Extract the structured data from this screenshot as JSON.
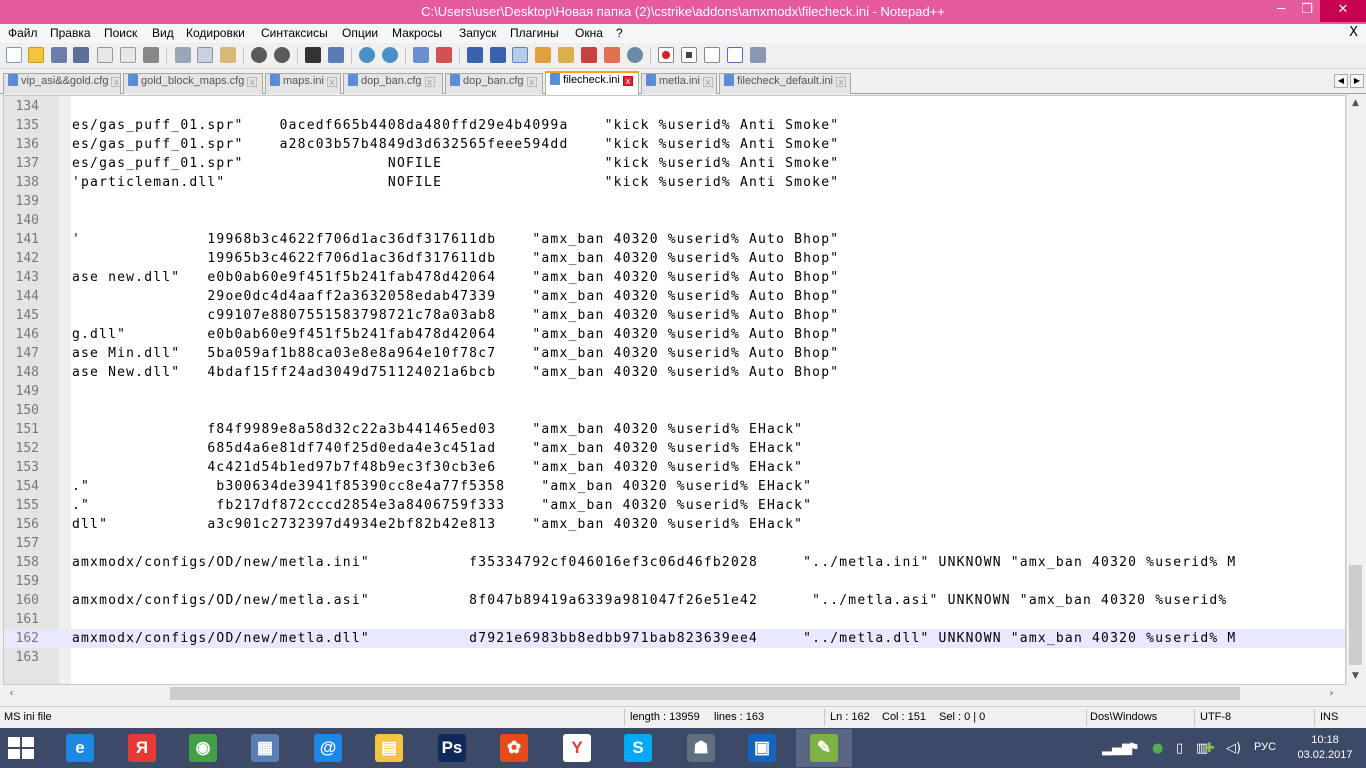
{
  "window": {
    "title": "C:\\Users\\user\\Desktop\\Новая папка (2)\\cstrike\\addons\\amxmodx\\filecheck.ini - Notepad++",
    "minimize": "─",
    "maximize": "❐",
    "close": "✕"
  },
  "menu": {
    "items": [
      "Файл",
      "Правка",
      "Поиск",
      "Вид",
      "Кодировки",
      "Синтаксисы",
      "Опции",
      "Макросы",
      "Запуск",
      "Плагины",
      "Окна",
      "?"
    ],
    "close_doc": "X"
  },
  "toolbar": {
    "icons": [
      "new-file-icon",
      "open-file-icon",
      "save-icon",
      "save-all-icon",
      "close-icon",
      "close-all-icon",
      "print-icon",
      "cut-icon",
      "copy-icon",
      "paste-icon",
      "undo-icon",
      "redo-icon",
      "find-icon",
      "replace-icon",
      "zoom-in-icon",
      "zoom-out-icon",
      "sync-v-icon",
      "sync-h-icon",
      "word-wrap-icon",
      "show-all-chars-icon",
      "indent-guide-icon",
      "udl-icon",
      "doc-map-icon",
      "function-list-icon",
      "folder-workspace-icon",
      "monitoring-icon",
      "record-macro-icon",
      "stop-macro-icon",
      "play-macro-icon",
      "play-multiple-icon",
      "save-macro-icon"
    ]
  },
  "tabs": [
    {
      "label": "vip_asi&&gold.cfg",
      "active": false
    },
    {
      "label": "gold_block_maps.cfg",
      "active": false
    },
    {
      "label": "maps.ini",
      "active": false
    },
    {
      "label": "dop_ban.cfg",
      "active": false
    },
    {
      "label": "dop_ban.cfg",
      "active": false
    },
    {
      "label": "filecheck.ini",
      "active": true
    },
    {
      "label": "metla.ini",
      "active": false
    },
    {
      "label": "filecheck_default.ini",
      "active": false
    }
  ],
  "editor": {
    "current_line": "162",
    "lines": [
      {
        "n": "134",
        "t": ""
      },
      {
        "n": "135",
        "t": "es/gas_puff_01.spr\"    0acedf665b4408da480ffd29e4b4099a    \"kick %userid% Anti Smoke\""
      },
      {
        "n": "136",
        "t": "es/gas_puff_01.spr\"    a28c03b57b4849d3d632565feee594dd    \"kick %userid% Anti Smoke\""
      },
      {
        "n": "137",
        "t": "es/gas_puff_01.spr\"                NOFILE                  \"kick %userid% Anti Smoke\""
      },
      {
        "n": "138",
        "t": "'particleman.dll\"                  NOFILE                  \"kick %userid% Anti Smoke\""
      },
      {
        "n": "139",
        "t": ""
      },
      {
        "n": "140",
        "t": ""
      },
      {
        "n": "141",
        "t": "'              19968b3c4622f706d1ac36df317611db    \"amx_ban 40320 %userid% Auto Bhop\""
      },
      {
        "n": "142",
        "t": "               19965b3c4622f706d1ac36df317611db    \"amx_ban 40320 %userid% Auto Bhop\""
      },
      {
        "n": "143",
        "t": "ase new.dll\"   e0b0ab60e9f451f5b241fab478d42064    \"amx_ban 40320 %userid% Auto Bhop\""
      },
      {
        "n": "144",
        "t": "               29oe0dc4d4aaff2a3632058edab47339    \"amx_ban 40320 %userid% Auto Bhop\""
      },
      {
        "n": "145",
        "t": "               c99107e8807551583798721c78a03ab8    \"amx_ban 40320 %userid% Auto Bhop\""
      },
      {
        "n": "146",
        "t": "g.dll\"         e0b0ab60e9f451f5b241fab478d42064    \"amx_ban 40320 %userid% Auto Bhop\""
      },
      {
        "n": "147",
        "t": "ase Min.dll\"   5ba059af1b88ca03e8e8a964e10f78c7    \"amx_ban 40320 %userid% Auto Bhop\""
      },
      {
        "n": "148",
        "t": "ase New.dll\"   4bdaf15ff24ad3049d751124021a6bcb    \"amx_ban 40320 %userid% Auto Bhop\""
      },
      {
        "n": "149",
        "t": ""
      },
      {
        "n": "150",
        "t": ""
      },
      {
        "n": "151",
        "t": "               f84f9989e8a58d32c22a3b441465ed03    \"amx_ban 40320 %userid% EHack\""
      },
      {
        "n": "152",
        "t": "               685d4a6e81df740f25d0eda4e3c451ad    \"amx_ban 40320 %userid% EHack\""
      },
      {
        "n": "153",
        "t": "               4c421d54b1ed97b7f48b9ec3f30cb3e6    \"amx_ban 40320 %userid% EHack\""
      },
      {
        "n": "154",
        "t": ".\"              b300634de3941f85390cc8e4a77f5358    \"amx_ban 40320 %userid% EHack\""
      },
      {
        "n": "155",
        "t": ".\"              fb217df872cccd2854e3a8406759f333    \"amx_ban 40320 %userid% EHack\""
      },
      {
        "n": "156",
        "t": "dll\"           a3c901c2732397d4934e2bf82b42e813    \"amx_ban 40320 %userid% EHack\""
      },
      {
        "n": "157",
        "t": ""
      },
      {
        "n": "158",
        "t": "amxmodx/configs/OD/new/metla.ini\"           f35334792cf046016ef3c06d46fb2028     \"../metla.ini\" UNKNOWN \"amx_ban 40320 %userid% M"
      },
      {
        "n": "159",
        "t": ""
      },
      {
        "n": "160",
        "t": "amxmodx/configs/OD/new/metla.asi\"           8f047b89419a6339a981047f26e51e42      \"../metla.asi\" UNKNOWN \"amx_ban 40320 %userid%"
      },
      {
        "n": "161",
        "t": ""
      },
      {
        "n": "162",
        "t": "amxmodx/configs/OD/new/metla.dll\"           d7921e6983bb8edbb971bab823639ee4     \"../metla.dll\" UNKNOWN \"amx_ban 40320 %userid% M"
      },
      {
        "n": "163",
        "t": ""
      }
    ]
  },
  "statusbar": {
    "file_type": "MS ini file",
    "length": "length : 13959",
    "lines": "lines : 163",
    "ln": "Ln : 162",
    "col": "Col : 151",
    "sel": "Sel : 0 | 0",
    "eol": "Dos\\Windows",
    "encoding": "UTF-8",
    "mode": "INS"
  },
  "taskbar": {
    "apps": [
      {
        "name": "internet-explorer-icon",
        "glyph": "e",
        "color": "#1e88e5"
      },
      {
        "name": "yandex-icon",
        "glyph": "Я",
        "color": "#e53935"
      },
      {
        "name": "chrome-icon",
        "glyph": "◉",
        "color": "#43a047"
      },
      {
        "name": "network-app-icon",
        "glyph": "▦",
        "color": "#5c7fb3"
      },
      {
        "name": "mail-icon",
        "glyph": "@",
        "color": "#1e88e5"
      },
      {
        "name": "file-explorer-icon",
        "glyph": "▤",
        "color": "#f4c542"
      },
      {
        "name": "photoshop-icon",
        "glyph": "Ps",
        "color": "#0f2a5a"
      },
      {
        "name": "media-player-icon",
        "glyph": "✿",
        "color": "#e64a19"
      },
      {
        "name": "yandex-browser-icon",
        "glyph": "Y",
        "color": "#ffffff"
      },
      {
        "name": "skype-icon",
        "glyph": "S",
        "color": "#03a9f4"
      },
      {
        "name": "counter-strike-icon",
        "glyph": "☗",
        "color": "#607080"
      },
      {
        "name": "disk-app-icon",
        "glyph": "▣",
        "color": "#1565c0"
      },
      {
        "name": "notepadpp-icon",
        "glyph": "✎",
        "color": "#7cb342"
      }
    ],
    "active_app": "notepadpp-icon",
    "language": "РУС",
    "time": "10:18",
    "date": "03.02.2017"
  }
}
